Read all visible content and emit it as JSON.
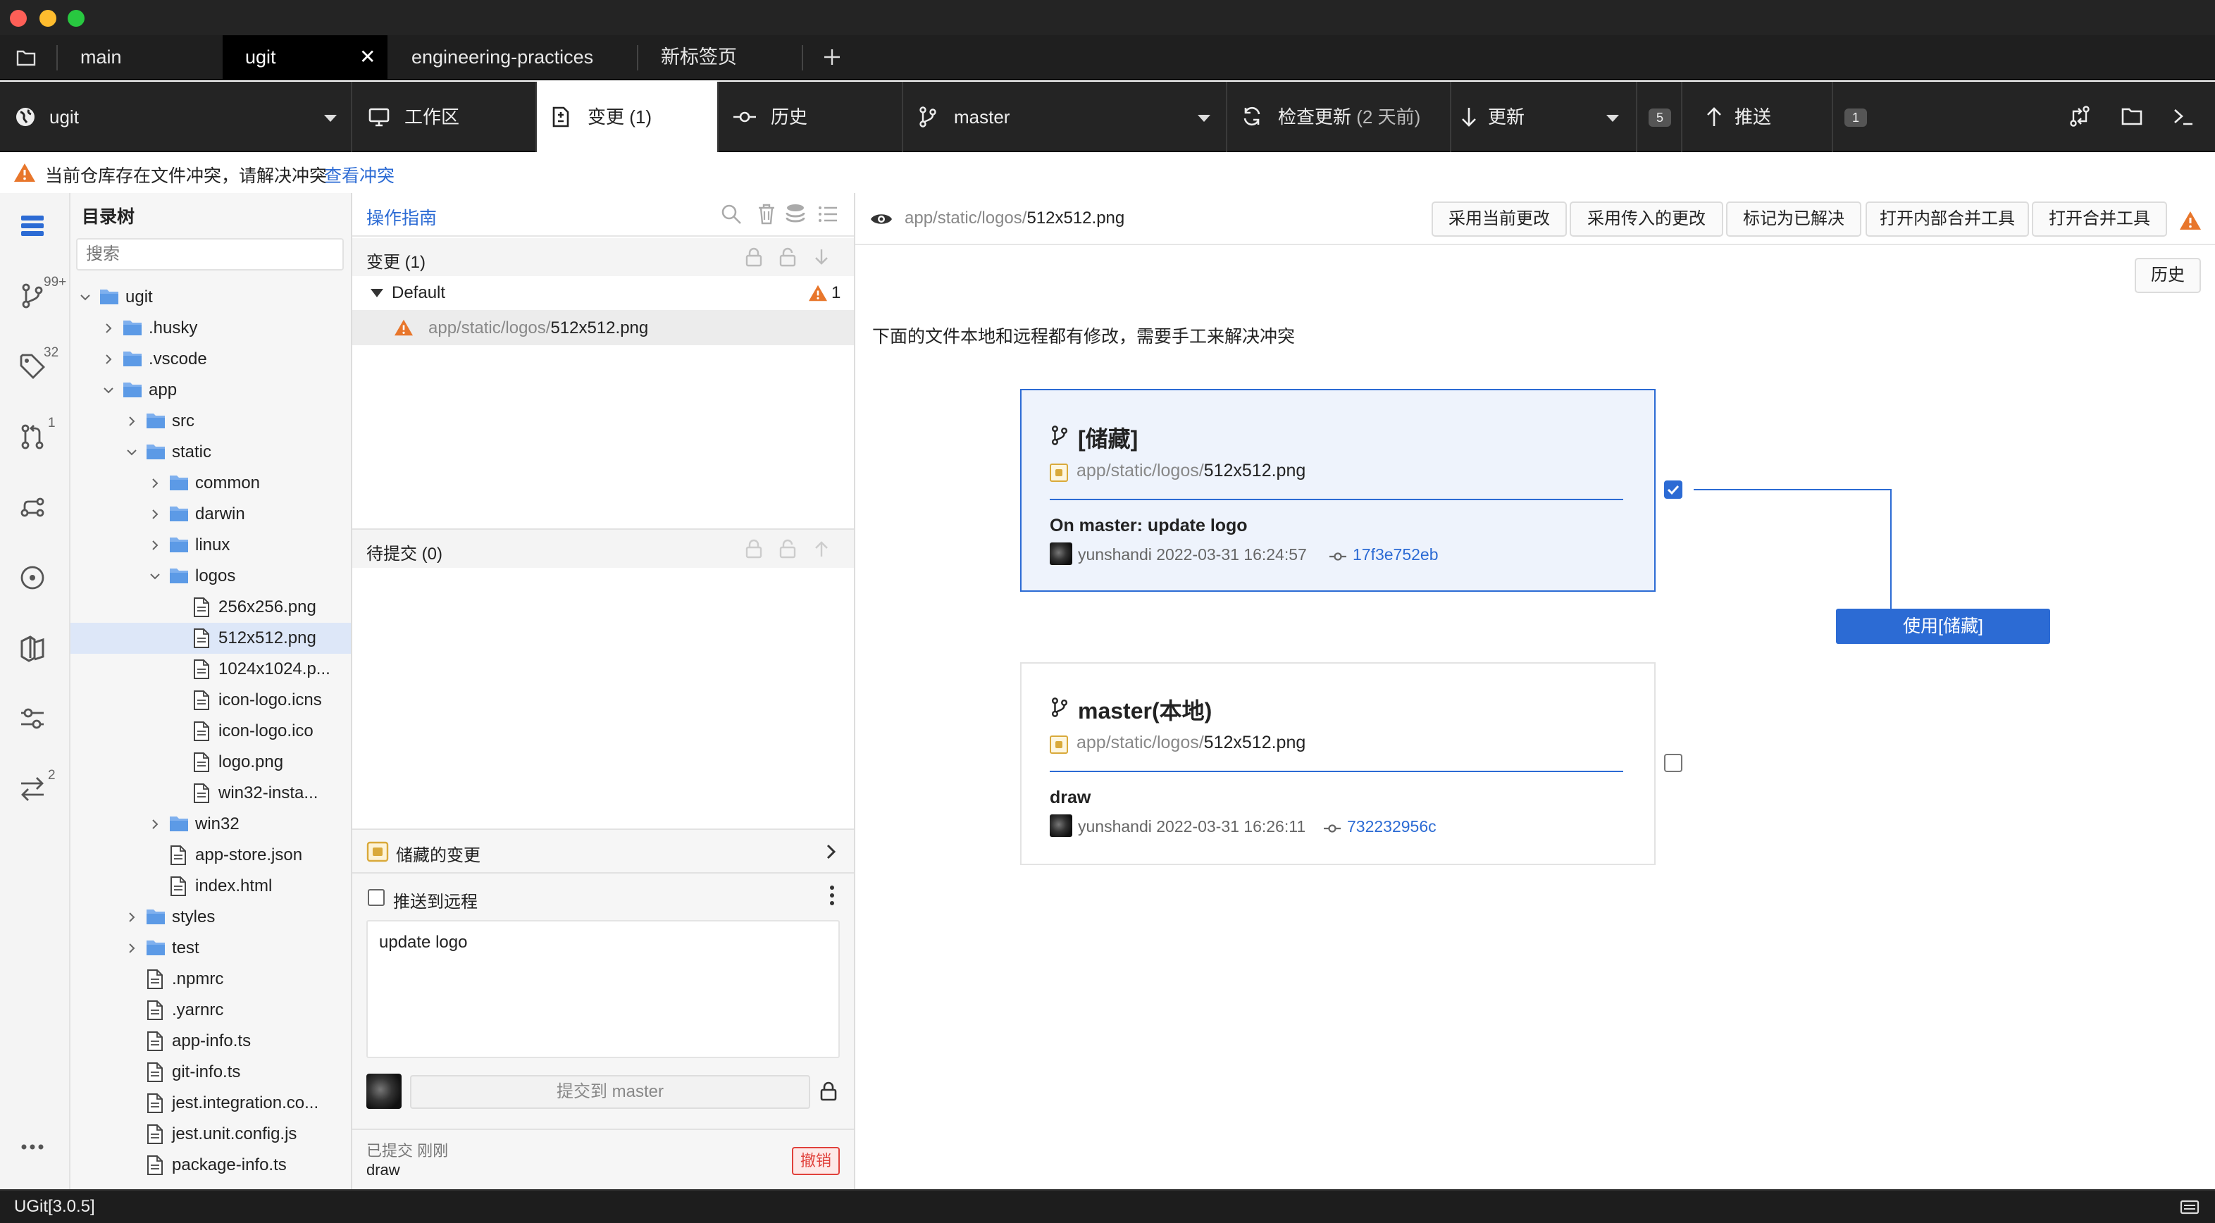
{
  "window": {
    "traffic_lights": [
      "#fe5f57",
      "#febc2e",
      "#28c840"
    ]
  },
  "tabs": [
    {
      "label": "main"
    },
    {
      "label": "ugit",
      "active": true
    },
    {
      "label": "engineering-practices"
    },
    {
      "label": "新标签页"
    }
  ],
  "toolbar": {
    "repo": "ugit",
    "workspace": "工作区",
    "changes": "变更 (1)",
    "history": "历史",
    "branch": "master",
    "check_updates": "检查更新",
    "check_updates_time": "(2 天前)",
    "pull": "更新",
    "pull_count": "5",
    "push": "推送",
    "push_count": "1"
  },
  "warning": {
    "text": "当前仓库存在文件冲突，请解决冲突",
    "link": "查看冲突"
  },
  "rail": {
    "branches_badge": "99+",
    "tags_badge": "32",
    "pr_badge": "1",
    "sync_badge": "2"
  },
  "tree": {
    "title": "目录树",
    "search_placeholder": "搜索",
    "items": [
      {
        "label": "ugit",
        "type": "folder",
        "depth": 0,
        "open": true
      },
      {
        "label": ".husky",
        "type": "folder",
        "depth": 1
      },
      {
        "label": ".vscode",
        "type": "folder",
        "depth": 1
      },
      {
        "label": "app",
        "type": "folder",
        "depth": 1,
        "open": true
      },
      {
        "label": "src",
        "type": "folder",
        "depth": 2
      },
      {
        "label": "static",
        "type": "folder",
        "depth": 2,
        "open": true
      },
      {
        "label": "common",
        "type": "folder",
        "depth": 3
      },
      {
        "label": "darwin",
        "type": "folder",
        "depth": 3
      },
      {
        "label": "linux",
        "type": "folder",
        "depth": 3
      },
      {
        "label": "logos",
        "type": "folder",
        "depth": 3,
        "open": true
      },
      {
        "label": "256x256.png",
        "type": "file",
        "depth": 4
      },
      {
        "label": "512x512.png",
        "type": "file",
        "depth": 4,
        "selected": true
      },
      {
        "label": "1024x1024.p...",
        "type": "file",
        "depth": 4
      },
      {
        "label": "icon-logo.icns",
        "type": "file",
        "depth": 4
      },
      {
        "label": "icon-logo.ico",
        "type": "file",
        "depth": 4
      },
      {
        "label": "logo.png",
        "type": "file",
        "depth": 4
      },
      {
        "label": "win32-insta...",
        "type": "file",
        "depth": 4
      },
      {
        "label": "win32",
        "type": "folder",
        "depth": 3
      },
      {
        "label": "app-store.json",
        "type": "file",
        "depth": 3
      },
      {
        "label": "index.html",
        "type": "file",
        "depth": 3
      },
      {
        "label": "styles",
        "type": "folder",
        "depth": 2
      },
      {
        "label": "test",
        "type": "folder",
        "depth": 2
      },
      {
        "label": ".npmrc",
        "type": "file",
        "depth": 2
      },
      {
        "label": ".yarnrc",
        "type": "file",
        "depth": 2
      },
      {
        "label": "app-info.ts",
        "type": "file",
        "depth": 2
      },
      {
        "label": "git-info.ts",
        "type": "file",
        "depth": 2
      },
      {
        "label": "jest.integration.co...",
        "type": "file",
        "depth": 2
      },
      {
        "label": "jest.unit.config.js",
        "type": "file",
        "depth": 2
      },
      {
        "label": "package-info.ts",
        "type": "file",
        "depth": 2
      }
    ]
  },
  "changes": {
    "guide": "操作指南",
    "section_title": "变更 (1)",
    "group": "Default",
    "group_count": "1",
    "file_dir": "app/static/logos/",
    "file_name": "512x512.png",
    "staged_title": "待提交 (0)",
    "stash_title": "储藏的变更",
    "push_remote": "推送到远程",
    "commit_message": "update logo",
    "commit_button": "提交到 master",
    "committed_label": "已提交",
    "committed_time": "刚刚",
    "committed_msg": "draw",
    "undo": "撤销"
  },
  "conflict": {
    "file_dir": "app/static/logos/",
    "file_name": "512x512.png",
    "buttons": [
      "采用当前更改",
      "采用传入的更改",
      "标记为已解决",
      "打开内部合并工具",
      "打开合并工具"
    ],
    "history": "历史",
    "description": "下面的文件本地和远程都有修改，需要手工来解决冲突",
    "use_button": "使用[储藏]",
    "stash": {
      "title": "[储藏]",
      "file_dir": "app/static/logos/",
      "file_name": "512x512.png",
      "message": "On master: update logo",
      "author": "yunshandi",
      "date": "2022-03-31 16:24:57",
      "hash": "17f3e752eb",
      "checked": true
    },
    "local": {
      "title": "master(本地)",
      "file_dir": "app/static/logos/",
      "file_name": "512x512.png",
      "message": "draw",
      "author": "yunshandi",
      "date": "2022-03-31 16:26:11",
      "hash": "732232956c",
      "checked": false
    }
  },
  "status": {
    "version": "UGit[3.0.5]"
  }
}
